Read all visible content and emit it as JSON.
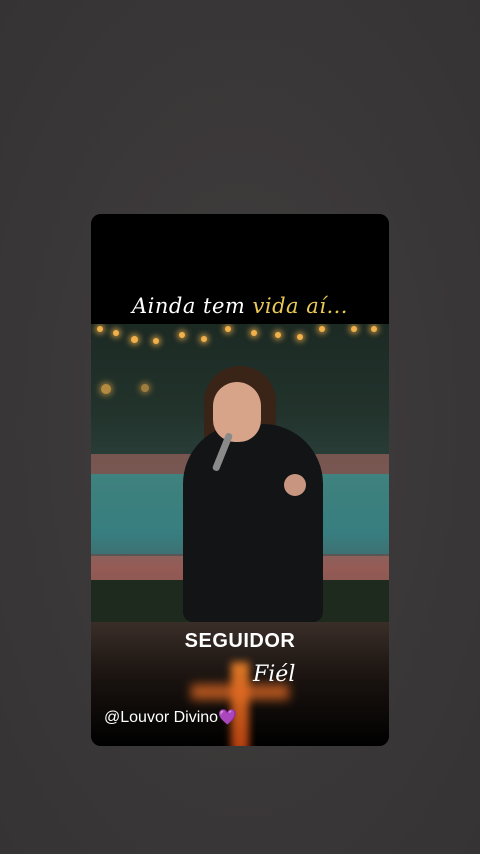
{
  "overlay": {
    "title_part1": "Ainda tem ",
    "title_part2": "vida aí...",
    "headline": "SEGUIDOR",
    "subhead": "Fiél",
    "handle": "@Louvor Divino",
    "heart": "💜"
  },
  "colors": {
    "page_background": "#3a3839",
    "title_highlight": "#e8c857",
    "heart": "#a25ad8"
  }
}
